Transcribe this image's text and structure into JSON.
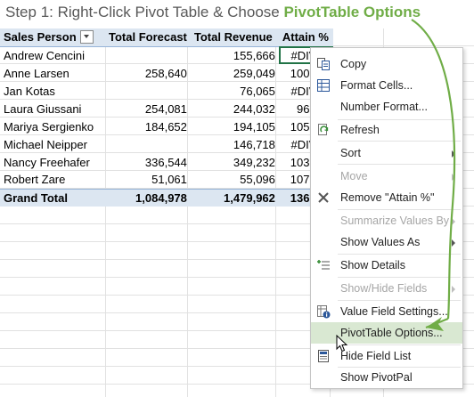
{
  "caption": {
    "prefix": "Step 1: Right-Click Pivot Table & Choose ",
    "highlight": "PivotTable Options"
  },
  "pivot": {
    "headers": [
      "Sales Person",
      "Total Forecast",
      "Total Revenue",
      "Attain %"
    ],
    "rows": [
      {
        "name": "Andrew Cencini",
        "forecast": "",
        "revenue": "155,666",
        "attain": "#DIV/0!"
      },
      {
        "name": "Anne Larsen",
        "forecast": "258,640",
        "revenue": "259,049",
        "attain": "100.2%"
      },
      {
        "name": "Jan Kotas",
        "forecast": "",
        "revenue": "76,065",
        "attain": "#DIV/0!"
      },
      {
        "name": "Laura Giussani",
        "forecast": "254,081",
        "revenue": "244,032",
        "attain": "96.0%"
      },
      {
        "name": "Mariya Sergienko",
        "forecast": "184,652",
        "revenue": "194,105",
        "attain": "105.1%"
      },
      {
        "name": "Michael Neipper",
        "forecast": "",
        "revenue": "146,718",
        "attain": "#DIV/0!"
      },
      {
        "name": "Nancy Freehafer",
        "forecast": "336,544",
        "revenue": "349,232",
        "attain": "103.8%"
      },
      {
        "name": "Robert Zare",
        "forecast": "51,061",
        "revenue": "55,096",
        "attain": "107.9%"
      }
    ],
    "total": {
      "name": "Grand Total",
      "forecast": "1,084,978",
      "revenue": "1,479,962",
      "attain": "136.4%"
    }
  },
  "context_menu": {
    "items": [
      {
        "label": "Copy",
        "icon": "copy-icon",
        "enabled": true
      },
      {
        "label": "Format Cells...",
        "icon": "format-cells-icon",
        "enabled": true
      },
      {
        "label": "Number Format...",
        "icon": "",
        "enabled": true
      },
      {
        "label": "Refresh",
        "icon": "refresh-icon",
        "enabled": true
      },
      {
        "label": "Sort",
        "icon": "",
        "enabled": true,
        "submenu": true
      },
      {
        "label": "Move",
        "icon": "",
        "enabled": false,
        "submenu": true
      },
      {
        "label": "Remove \"Attain %\"",
        "icon": "remove-x-icon",
        "enabled": true
      },
      {
        "label": "Summarize Values By",
        "icon": "",
        "enabled": false,
        "submenu": true
      },
      {
        "label": "Show Values As",
        "icon": "",
        "enabled": true,
        "submenu": true
      },
      {
        "label": "Show Details",
        "icon": "show-details-icon",
        "enabled": true
      },
      {
        "label": "Show/Hide Fields",
        "icon": "",
        "enabled": false,
        "submenu": true
      },
      {
        "label": "Value Field Settings...",
        "icon": "value-field-settings-icon",
        "enabled": true
      },
      {
        "label": "PivotTable Options...",
        "icon": "",
        "enabled": true,
        "hover": true
      },
      {
        "label": "Hide Field List",
        "icon": "field-list-icon",
        "enabled": true
      },
      {
        "label": "Show PivotPal",
        "icon": "",
        "enabled": true
      }
    ]
  },
  "colors": {
    "accent_green": "#70ad47",
    "pivot_header_fill": "#dce6f1",
    "menu_hover": "#d9e8d2",
    "cell_selection": "#217346"
  }
}
